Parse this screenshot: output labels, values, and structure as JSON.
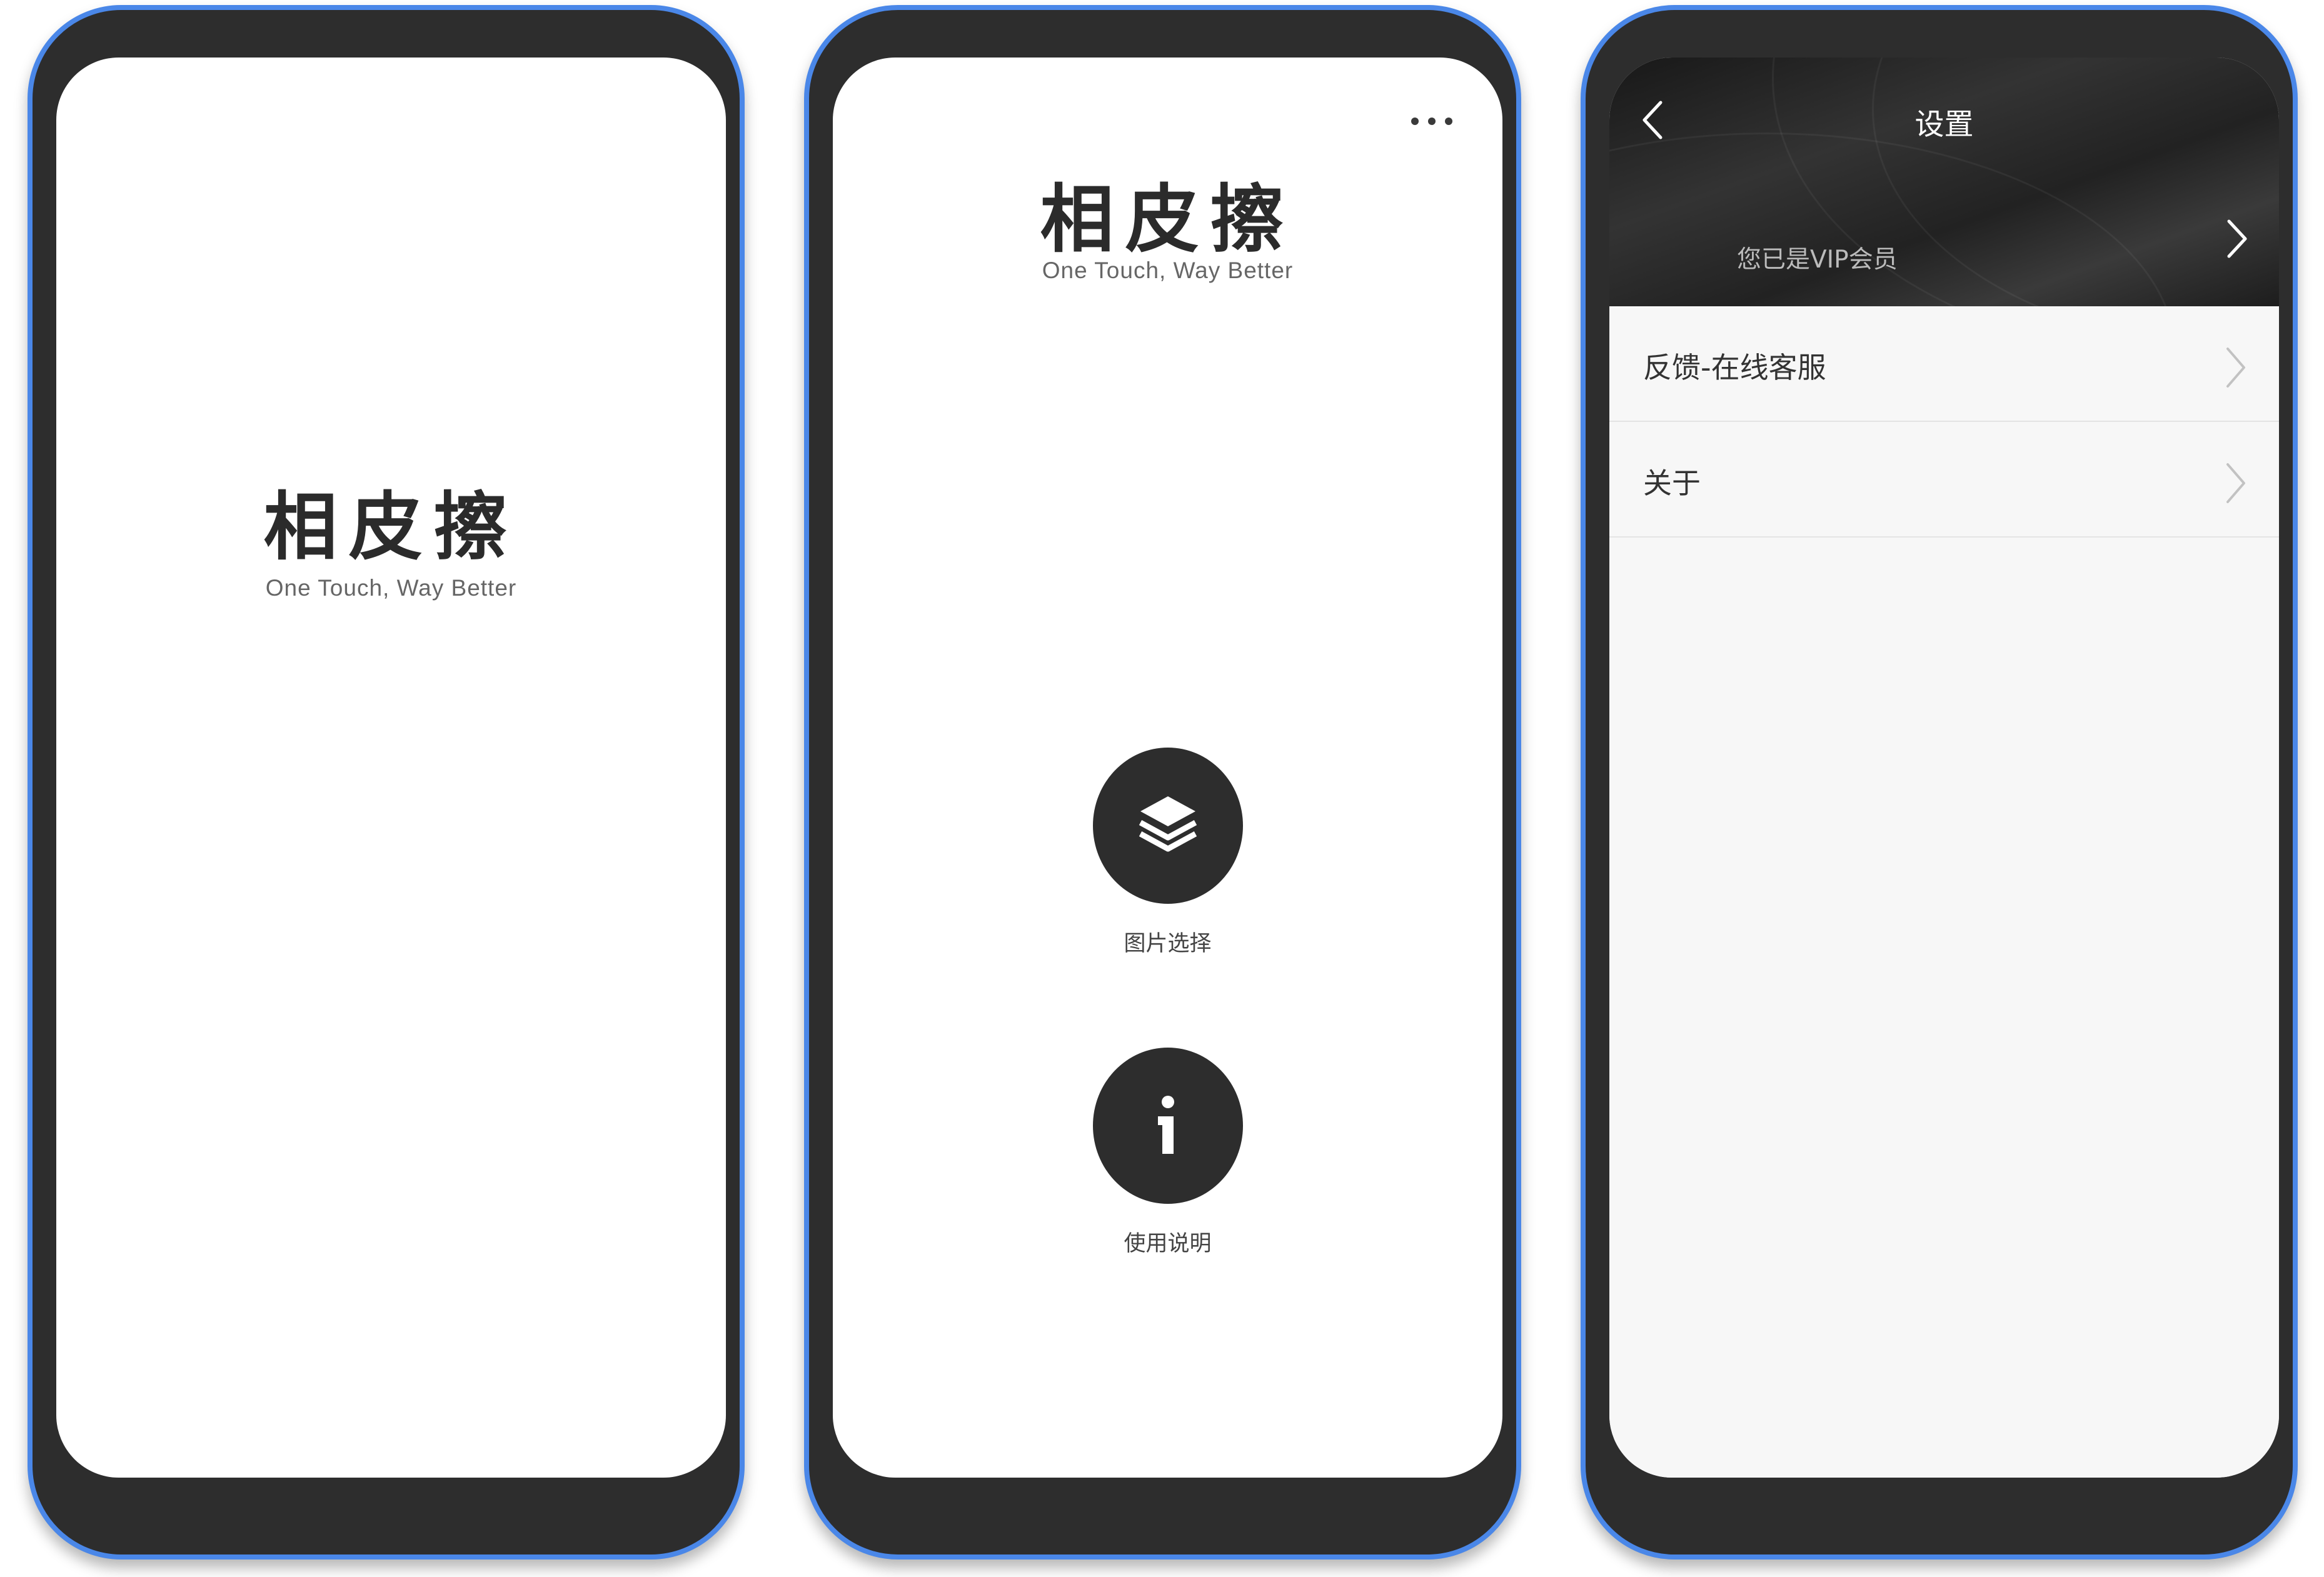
{
  "app": {
    "name": "相皮擦",
    "tagline": "One Touch, Way Better"
  },
  "home": {
    "more_icon": "more-horizontal-icon",
    "buttons": [
      {
        "label": "图片选择",
        "icon": "layers-icon"
      },
      {
        "label": "使用说明",
        "icon": "info-icon"
      }
    ]
  },
  "settings": {
    "title": "设置",
    "vip_text": "您已是VIP会员",
    "items": [
      {
        "label": "反馈-在线客服"
      },
      {
        "label": "关于"
      }
    ]
  },
  "colors": {
    "frame_border": "#4a87e8",
    "frame_body": "#2d2d2d",
    "button_fill": "#2d2d2d",
    "list_background": "#f7f7f7"
  }
}
